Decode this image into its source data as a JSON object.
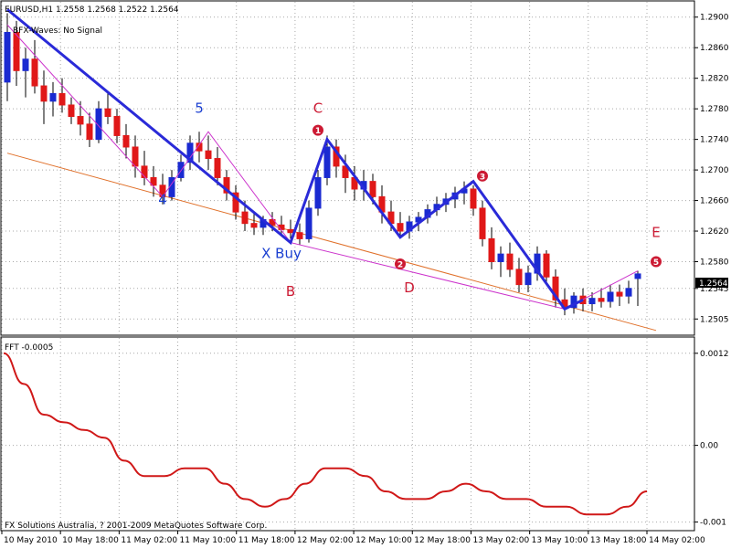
{
  "header": {
    "symbol_line": "EURUSD,H1  1.2558 1.2568 1.2522 1.2564",
    "indicator_line": "BFX-Waves: No Signal"
  },
  "chart_data": [
    {
      "type": "candlestick",
      "ylim": [
        1.2485,
        1.292
      ],
      "current_price": "1.2564",
      "price_ticks": [
        "1.2900",
        "1.2860",
        "1.2820",
        "1.2780",
        "1.2740",
        "1.2700",
        "1.2660",
        "1.2620",
        "1.2580",
        "1.2545",
        "1.2505"
      ],
      "time_ticks": [
        "10 May 2010",
        "10 May 18:00",
        "11 May 02:00",
        "11 May 10:00",
        "11 May 18:00",
        "12 May 02:00",
        "12 May 10:00",
        "12 May 18:00",
        "13 May 02:00",
        "13 May 10:00",
        "13 May 18:00",
        "14 May 02:00"
      ],
      "candles": [
        [
          1.2815,
          1.2905,
          1.279,
          1.288
        ],
        [
          1.288,
          1.2895,
          1.281,
          1.283
        ],
        [
          1.283,
          1.286,
          1.2795,
          1.2845
        ],
        [
          1.2845,
          1.287,
          1.28,
          1.281
        ],
        [
          1.281,
          1.283,
          1.276,
          1.279
        ],
        [
          1.279,
          1.2815,
          1.277,
          1.28
        ],
        [
          1.28,
          1.282,
          1.2775,
          1.2785
        ],
        [
          1.2785,
          1.2795,
          1.276,
          1.277
        ],
        [
          1.277,
          1.279,
          1.2745,
          1.276
        ],
        [
          1.276,
          1.2775,
          1.273,
          1.274
        ],
        [
          1.274,
          1.279,
          1.2735,
          1.278
        ],
        [
          1.278,
          1.28,
          1.276,
          1.277
        ],
        [
          1.277,
          1.278,
          1.2735,
          1.2745
        ],
        [
          1.2745,
          1.276,
          1.2715,
          1.273
        ],
        [
          1.273,
          1.2745,
          1.269,
          1.2705
        ],
        [
          1.2705,
          1.2725,
          1.268,
          1.269
        ],
        [
          1.269,
          1.2705,
          1.2665,
          1.268
        ],
        [
          1.268,
          1.2695,
          1.2655,
          1.2665
        ],
        [
          1.2665,
          1.27,
          1.266,
          1.269
        ],
        [
          1.269,
          1.272,
          1.2685,
          1.271
        ],
        [
          1.271,
          1.2745,
          1.27,
          1.2735
        ],
        [
          1.2735,
          1.275,
          1.271,
          1.2725
        ],
        [
          1.2725,
          1.2745,
          1.27,
          1.2715
        ],
        [
          1.2715,
          1.273,
          1.268,
          1.269
        ],
        [
          1.269,
          1.27,
          1.266,
          1.267
        ],
        [
          1.267,
          1.268,
          1.2635,
          1.2645
        ],
        [
          1.2645,
          1.266,
          1.262,
          1.263
        ],
        [
          1.263,
          1.2645,
          1.2615,
          1.2625
        ],
        [
          1.2625,
          1.264,
          1.2615,
          1.2635
        ],
        [
          1.2635,
          1.2645,
          1.262,
          1.2628
        ],
        [
          1.2628,
          1.264,
          1.2615,
          1.2622
        ],
        [
          1.2622,
          1.2635,
          1.261,
          1.2618
        ],
        [
          1.2618,
          1.263,
          1.2602,
          1.261
        ],
        [
          1.261,
          1.266,
          1.2605,
          1.265
        ],
        [
          1.265,
          1.27,
          1.264,
          1.269
        ],
        [
          1.269,
          1.2745,
          1.268,
          1.273
        ],
        [
          1.273,
          1.274,
          1.269,
          1.2705
        ],
        [
          1.2705,
          1.272,
          1.267,
          1.269
        ],
        [
          1.269,
          1.2705,
          1.266,
          1.2675
        ],
        [
          1.2675,
          1.27,
          1.266,
          1.2685
        ],
        [
          1.2685,
          1.2695,
          1.2655,
          1.2665
        ],
        [
          1.2665,
          1.268,
          1.263,
          1.2645
        ],
        [
          1.2645,
          1.266,
          1.262,
          1.263
        ],
        [
          1.263,
          1.2645,
          1.2612,
          1.262
        ],
        [
          1.262,
          1.264,
          1.261,
          1.2632
        ],
        [
          1.2632,
          1.2645,
          1.262,
          1.2638
        ],
        [
          1.2638,
          1.2655,
          1.263,
          1.2648
        ],
        [
          1.2648,
          1.2665,
          1.264,
          1.2655
        ],
        [
          1.2655,
          1.267,
          1.2645,
          1.2662
        ],
        [
          1.2662,
          1.2678,
          1.265,
          1.267
        ],
        [
          1.267,
          1.2685,
          1.2655,
          1.2675
        ],
        [
          1.2675,
          1.268,
          1.264,
          1.265
        ],
        [
          1.265,
          1.266,
          1.26,
          1.261
        ],
        [
          1.261,
          1.2625,
          1.257,
          1.258
        ],
        [
          1.258,
          1.26,
          1.256,
          1.259
        ],
        [
          1.259,
          1.2605,
          1.256,
          1.257
        ],
        [
          1.257,
          1.2585,
          1.254,
          1.255
        ],
        [
          1.255,
          1.2575,
          1.254,
          1.2565
        ],
        [
          1.2565,
          1.26,
          1.2555,
          1.259
        ],
        [
          1.259,
          1.2595,
          1.255,
          1.256
        ],
        [
          1.256,
          1.257,
          1.252,
          1.253
        ],
        [
          1.253,
          1.2545,
          1.251,
          1.252
        ],
        [
          1.252,
          1.254,
          1.2512,
          1.2535
        ],
        [
          1.2535,
          1.2545,
          1.2515,
          1.2525
        ],
        [
          1.2525,
          1.254,
          1.2515,
          1.2532
        ],
        [
          1.2532,
          1.2545,
          1.252,
          1.2528
        ],
        [
          1.2528,
          1.255,
          1.252,
          1.254
        ],
        [
          1.254,
          1.255,
          1.2522,
          1.2535
        ],
        [
          1.2535,
          1.2555,
          1.2525,
          1.2545
        ],
        [
          1.2558,
          1.2568,
          1.2522,
          1.2564
        ]
      ],
      "zigzag_blue": [
        [
          1.291,
          0
        ],
        [
          1.2605,
          31
        ],
        [
          1.274,
          35
        ],
        [
          1.2612,
          43
        ],
        [
          1.2685,
          51
        ],
        [
          1.2518,
          61
        ],
        [
          1.253,
          63
        ]
      ],
      "zigzag_magenta": [
        [
          1.289,
          0
        ],
        [
          1.2665,
          17
        ],
        [
          1.275,
          22
        ],
        [
          1.2605,
          31
        ],
        [
          1.2518,
          61
        ],
        [
          1.2568,
          69
        ]
      ],
      "trendline": [
        [
          1.2722,
          0
        ],
        [
          1.249,
          71
        ]
      ],
      "labels": [
        {
          "text": "4",
          "bar": 17,
          "price": 1.2655,
          "color": "#1a3fd1"
        },
        {
          "text": "5",
          "bar": 21,
          "price": 1.2775,
          "color": "#1a3fd1"
        },
        {
          "text": "X Buy",
          "bar": 30,
          "price": 1.2585,
          "color": "#1a3fd1"
        },
        {
          "text": "B",
          "bar": 31,
          "price": 1.2535,
          "color": "#cc1a33"
        },
        {
          "text": "C",
          "bar": 34,
          "price": 1.2775,
          "color": "#cc1a33"
        },
        {
          "text": "D",
          "bar": 44,
          "price": 1.254,
          "color": "#cc1a33"
        },
        {
          "text": "E",
          "bar": 71,
          "price": 1.2612,
          "color": "#cc1a33"
        }
      ],
      "markers": [
        {
          "text": "1",
          "bar": 34,
          "price": 1.2752
        },
        {
          "text": "3",
          "bar": 52,
          "price": 1.2692
        },
        {
          "text": "2",
          "bar": 43,
          "price": 1.2577
        },
        {
          "text": "5",
          "bar": 71,
          "price": 1.258
        }
      ]
    },
    {
      "type": "line",
      "label": "FFT -0.0005",
      "ylim": [
        -0.0011,
        0.0014
      ],
      "y_ticks": [
        "0.0012",
        "0.00",
        "-0.001"
      ],
      "values": [
        0.0012,
        0.0008,
        0.0004,
        0.0003,
        0.0002,
        0.0001,
        -0.0002,
        -0.0004,
        -0.0004,
        -0.0003,
        -0.0003,
        -0.0005,
        -0.0007,
        -0.0008,
        -0.0007,
        -0.0005,
        -0.0003,
        -0.0003,
        -0.0004,
        -0.0006,
        -0.0007,
        -0.0007,
        -0.0006,
        -0.0005,
        -0.0006,
        -0.0007,
        -0.0007,
        -0.0008,
        -0.0008,
        -0.0009,
        -0.0009,
        -0.0008,
        -0.0006
      ]
    }
  ],
  "copyright": "FX Solutions Australia, ? 2001-2009 MetaQuotes Software Corp."
}
